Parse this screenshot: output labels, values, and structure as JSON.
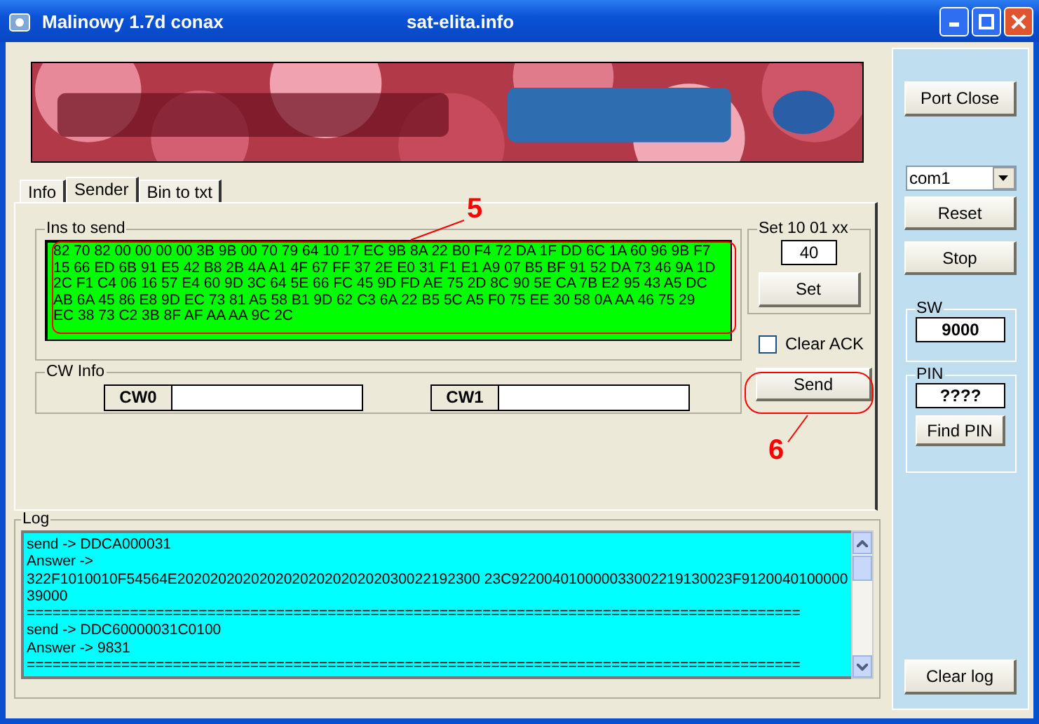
{
  "window": {
    "title": "Malinowy 1.7d conax",
    "subtitle": "sat-elita.info"
  },
  "tabs": [
    {
      "label": "Info",
      "selected": false
    },
    {
      "label": "Sender",
      "selected": true
    },
    {
      "label": "Bin to txt",
      "selected": false
    }
  ],
  "ins_to_send": {
    "label": "Ins to send",
    "lines": [
      "82 70 82 00 00 00 00 3B 9B 00 70 79 64 10 17 EC 9B 8A 22 B0 F4 72 DA 1F DD 6C 1A 60 96 9B F7",
      "15 66 ED 6B 91 E5 42 B8 2B 4A A1 4F 67 FF 37 2E E0 31 F1 E1 A9 07 B5 BF 91 52 DA 73 46 9A 1D",
      "2C F1 C4 06 16 57 E4 60 9D 3C 64 5E 66 FC 45 9D FD AE 75 2D 8C 90 5E CA 7B E2 95 43 A5 DC",
      "AB 6A 45 86 E8 9D EC 73 81 A5 58 B1 9D 62 C3 6A 22 B5 5C A5 F0 75 EE 30 58 0A AA 46 75 29",
      "EC 38 73 C2 3B 8F AF AA AA 9C 2C"
    ]
  },
  "set_group": {
    "label": "Set 10 01 xx",
    "value": "40",
    "button": "Set"
  },
  "clear_ack": {
    "label": "Clear ACK",
    "checked": false
  },
  "send_button": "Send",
  "cw_info": {
    "label": "CW Info",
    "fields": [
      {
        "label": "CW0"
      },
      {
        "label": "CW1"
      }
    ]
  },
  "annotations": [
    {
      "text": "5"
    },
    {
      "text": "6"
    }
  ],
  "log": {
    "label": "Log",
    "lines": [
      "send -> DDCA000031",
      "Answer ->",
      "322F1010010F54564E2020202020202020202020202030022192300 23C922004010000033002219130023F9120040100000",
      "39000",
      "==========================================================================================",
      "send -> DDC60000031C0100",
      "Answer -> 9831",
      "=========================================================================================="
    ]
  },
  "sidebar": {
    "port_button": "Port Close",
    "port_select": "com1",
    "reset_button": "Reset",
    "stop_button": "Stop",
    "sw": {
      "label": "SW",
      "value": "9000"
    },
    "pin": {
      "label": "PIN",
      "value": "????",
      "button": "Find PIN"
    },
    "clear_log_button": "Clear log"
  }
}
